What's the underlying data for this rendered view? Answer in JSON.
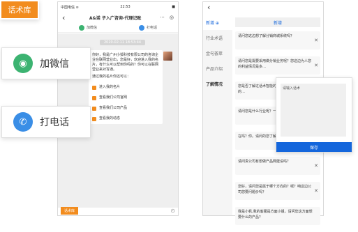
{
  "left_phone": {
    "status": {
      "carrier": "中国电信 ≋",
      "time": "22:53",
      "battery": "■"
    },
    "nav": {
      "back": "‹",
      "title": "A&诺 子入广咨询-代理记账",
      "more_icon": "···",
      "target_icon": "◎"
    },
    "actions": [
      {
        "label": "加微信",
        "icon": "wechat-icon"
      },
      {
        "label": "打电话",
        "icon": "phone-icon"
      }
    ],
    "timestamp": "2020-02-11 18:53:44",
    "message": "你好，我是广州小狐科技有限公司的咨询企业在联网营业出，您是好，欢迎进入我的名片，有什么可以帮到你吗的？你可以在联网营业来对写通。",
    "message_sub": "通过我的名片你还可以：",
    "menu": [
      {
        "label": "进入我的名片",
        "icon": "card-icon"
      },
      {
        "label": "查看我们公司官网",
        "icon": "web-icon"
      },
      {
        "label": "查看我们公司产品",
        "icon": "product-icon"
      },
      {
        "label": "查看我的动态",
        "icon": "feed-icon"
      }
    ],
    "bottom": {
      "button": "话术库",
      "camera_icon": "camera-icon"
    }
  },
  "callouts": {
    "wechat": "加微信",
    "phone": "打电话",
    "script": "话术库"
  },
  "right_phone": {
    "status": {
      "carrier": "中国电信 ≋",
      "time": "22:53",
      "battery": "■"
    },
    "sidebar": [
      {
        "label": "新增 ⊕",
        "active": true
      },
      {
        "label": "行业术语"
      },
      {
        "label": "金句荟萃"
      },
      {
        "label": "产品介绍"
      },
      {
        "label": "了解情况"
      }
    ],
    "header": "新增",
    "scripts": [
      "请问您这边想了解分销商城系统吗？",
      "请问您是需要采用做分销业务呢？您这边为人您的利益情况是多…",
      "您是否了解过话术智能的呢？想有更多的询问您的…",
      "请问您是什么行业呢？一个方面下方得本…",
      "在吗？你。请问的您了解 的体验都需要…",
      "请问贵公司有想做产品网建设吗？",
      "您好，请问您是属于哪个方向的？呢？咱这边公司您要问题价吗？",
      "我是小帆,我的客服是方面小姐，请问您这方面想要什么的产品?"
    ],
    "modal": {
      "placeholder": "请输入话术",
      "save": "保存"
    }
  },
  "colors": {
    "accent_blue": "#1466dc",
    "orange": "#f28c1e",
    "wechat_green": "#3cb371",
    "phone_blue": "#3a8ee6"
  }
}
